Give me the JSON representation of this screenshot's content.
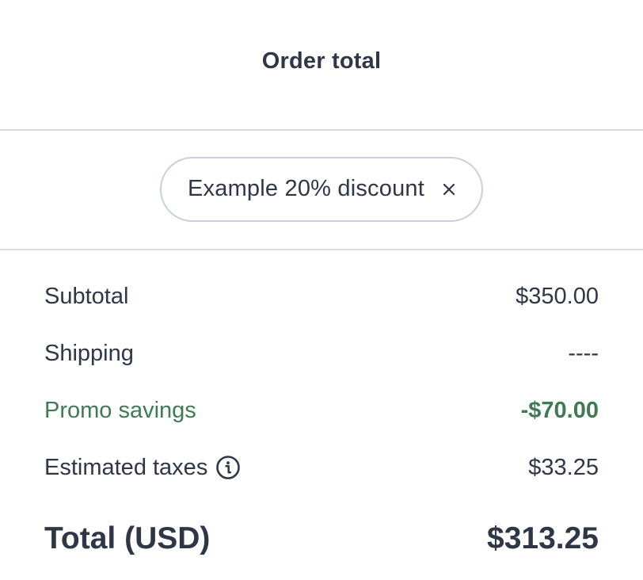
{
  "header": {
    "title": "Order total"
  },
  "promo": {
    "chip_label": "Example 20% discount",
    "remove_icon": "close-icon"
  },
  "summary": {
    "subtotal_label": "Subtotal",
    "subtotal_value": "$350.00",
    "shipping_label": "Shipping",
    "shipping_value": "----",
    "promo_label": "Promo savings",
    "promo_value": "-$70.00",
    "taxes_label": "Estimated taxes",
    "taxes_info_icon": "info-icon",
    "taxes_value": "$33.25",
    "total_label": "Total (USD)",
    "total_value": "$313.25"
  },
  "colors": {
    "text": "#2f3747",
    "divider": "#d4dbe3",
    "chip_border": "#c7d0db",
    "promo_green": "#3f7a54"
  }
}
